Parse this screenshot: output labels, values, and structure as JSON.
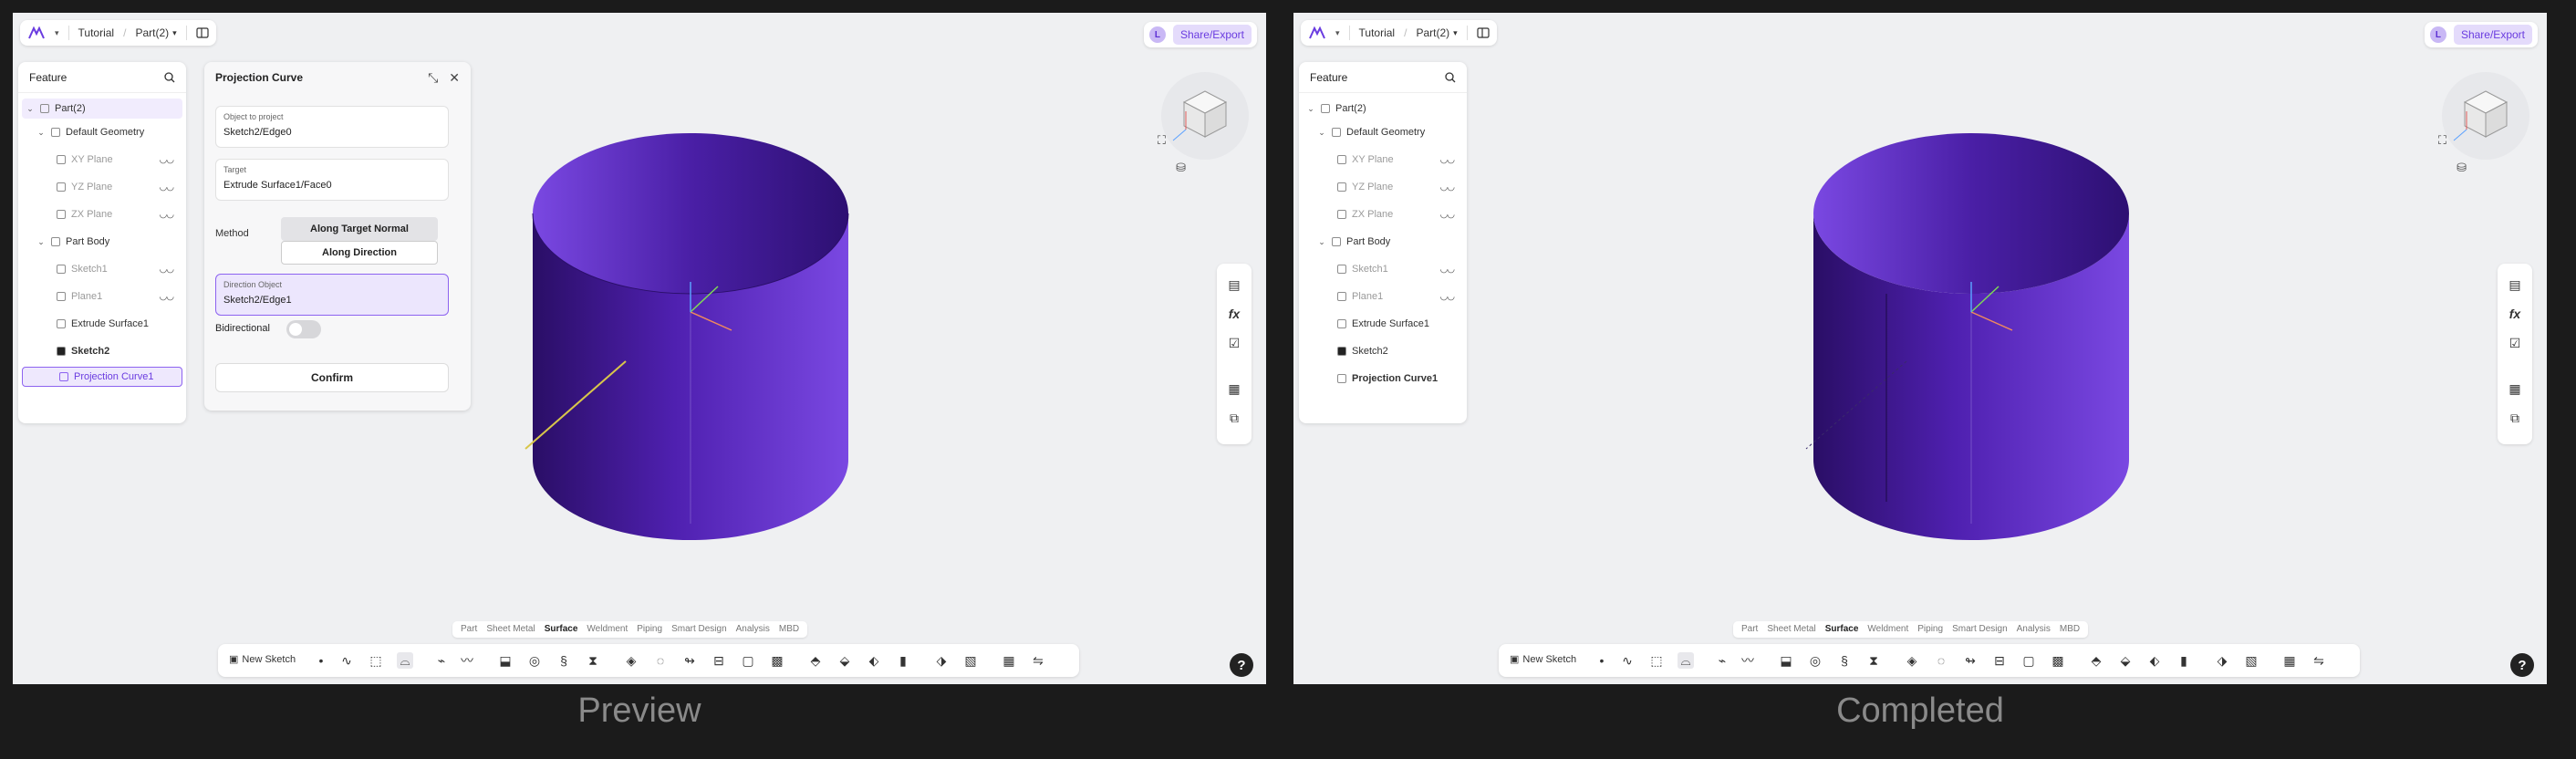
{
  "topbar": {
    "breadcrumb_tutorial": "Tutorial",
    "breadcrumb_part": "Part(2)",
    "avatar_letter": "L",
    "share_label": "Share/Export"
  },
  "feature_panel": {
    "title": "Feature",
    "items": [
      {
        "label": "Part(2)"
      },
      {
        "label": "Default Geometry"
      },
      {
        "label": "XY Plane"
      },
      {
        "label": "YZ Plane"
      },
      {
        "label": "ZX Plane"
      },
      {
        "label": "Part Body"
      },
      {
        "label": "Sketch1"
      },
      {
        "label": "Plane1"
      },
      {
        "label": "Extrude Surface1"
      },
      {
        "label": "Sketch2"
      },
      {
        "label": "Projection Curve1"
      }
    ]
  },
  "dialog": {
    "title": "Projection Curve",
    "object_label": "Object to project",
    "object_value": "Sketch2/Edge0",
    "target_label": "Target",
    "target_value": "Extrude Surface1/Face0",
    "method_label": "Method",
    "method_opt1": "Along Target Normal",
    "method_opt2": "Along Direction",
    "direction_label": "Direction Object",
    "direction_value": "Sketch2/Edge1",
    "bidirectional_label": "Bidirectional",
    "confirm_label": "Confirm"
  },
  "tabs": [
    "Part",
    "Sheet Metal",
    "Surface",
    "Weldment",
    "Piping",
    "Smart Design",
    "Analysis",
    "MBD"
  ],
  "active_tab": "Surface",
  "toolbar": {
    "new_sketch": "New Sketch"
  },
  "help": "?",
  "captions": {
    "left": "Preview",
    "right": "Completed"
  },
  "colors": {
    "accent": "#6a3ce0",
    "cylinder_dark": "#2e1270",
    "cylinder_mid": "#5d28c4",
    "cylinder_light": "#7a45e0"
  }
}
